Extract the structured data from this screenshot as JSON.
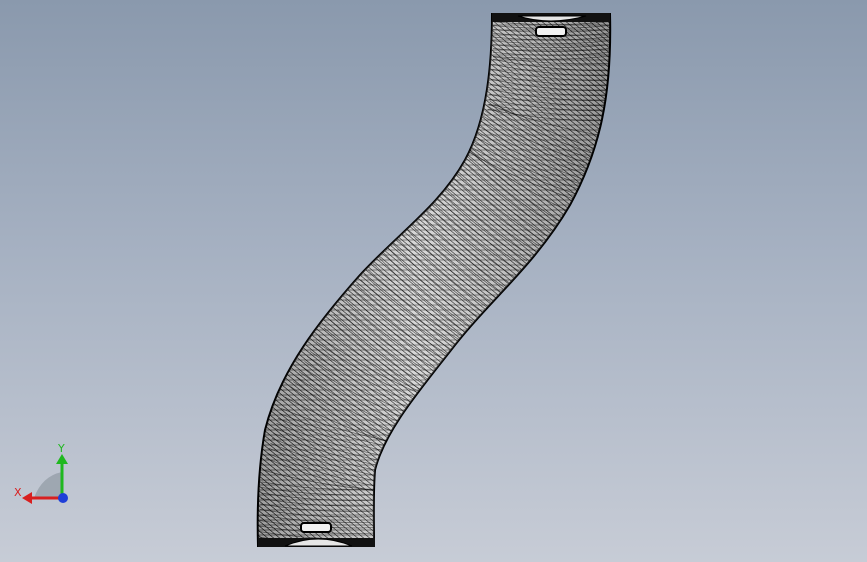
{
  "viewport": {
    "model": "s-bend-tube-mesh",
    "background_top": "#8a99ad",
    "background_bottom": "#c7ccd6",
    "mesh_color": "#000000",
    "surface_color": "#d9d9d9"
  },
  "triad": {
    "x_label": "X",
    "y_label": "Y",
    "x_color": "#d81f1f",
    "y_color": "#1fb81f",
    "z_color": "#1f3fd8"
  }
}
